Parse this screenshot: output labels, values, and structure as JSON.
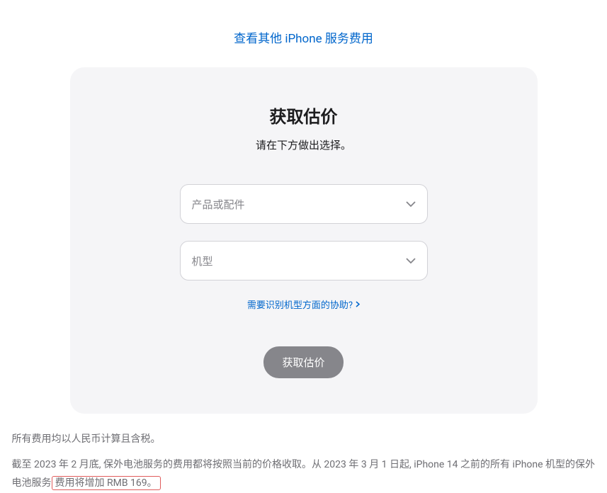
{
  "topLink": {
    "label": "查看其他 iPhone 服务费用"
  },
  "card": {
    "title": "获取估价",
    "subtitle": "请在下方做出选择。",
    "select1": {
      "placeholder": "产品或配件"
    },
    "select2": {
      "placeholder": "机型"
    },
    "helpLink": {
      "label": "需要识别机型方面的协助?"
    },
    "button": {
      "label": "获取估价"
    }
  },
  "disclaimer": {
    "line1": "所有费用均以人民币计算且含税。",
    "line2_part1": "截至 2023 年 2 月底, 保外电池服务的费用都将按照当前的价格收取。从 2023 年 3 月 1 日起, iPhone 14 之前的所有 iPhone 机型的保外电池服务",
    "line2_highlight": "费用将增加 RMB 169。"
  }
}
